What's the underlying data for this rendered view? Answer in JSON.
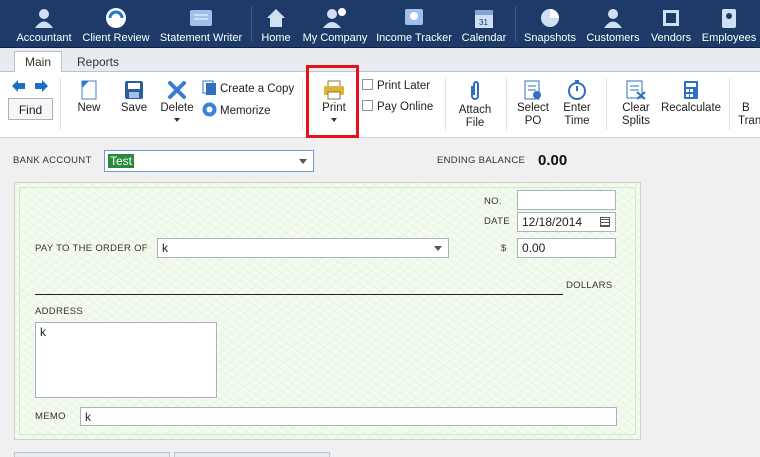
{
  "nav": {
    "items": [
      {
        "label": "Accountant",
        "icon": "accountant-icon"
      },
      {
        "label": "Client Review",
        "icon": "client-review-icon"
      },
      {
        "label": "Statement Writer",
        "icon": "statement-writer-icon"
      },
      {
        "label": "Home",
        "icon": "home-icon"
      },
      {
        "label": "My Company",
        "icon": "my-company-icon"
      },
      {
        "label": "Income Tracker",
        "icon": "income-tracker-icon"
      },
      {
        "label": "Calendar",
        "icon": "calendar-icon"
      },
      {
        "label": "Snapshots",
        "icon": "snapshots-icon"
      },
      {
        "label": "Customers",
        "icon": "customers-icon"
      },
      {
        "label": "Vendors",
        "icon": "vendors-icon"
      },
      {
        "label": "Employees",
        "icon": "employees-icon"
      }
    ]
  },
  "tabs": {
    "main": "Main",
    "reports": "Reports"
  },
  "toolbar": {
    "find": "Find",
    "new": "New",
    "save": "Save",
    "delete": "Delete",
    "create_copy": "Create a Copy",
    "memorize": "Memorize",
    "print": "Print",
    "print_later": "Print Later",
    "pay_online": "Pay Online",
    "attach_file_1": "Attach",
    "attach_file_2": "File",
    "select_po_1": "Select",
    "select_po_2": "PO",
    "enter_time_1": "Enter",
    "enter_time_2": "Time",
    "clear_splits_1": "Clear",
    "clear_splits_2": "Splits",
    "recalculate": "Recalculate",
    "batch_1": "B",
    "batch_2": "Tran"
  },
  "form": {
    "bank_account_label": "BANK ACCOUNT",
    "bank_account_value": "Test",
    "ending_balance_label": "ENDING BALANCE",
    "ending_balance_value": "0.00",
    "no_label": "NO.",
    "no_value": "",
    "date_label": "DATE",
    "date_value": "12/18/2014",
    "pay_to_label": "PAY TO THE ORDER OF",
    "pay_to_value": "k",
    "dollar_sign": "$",
    "amount_value": "0.00",
    "dollars_label": "DOLLARS",
    "address_label": "ADDRESS",
    "address_value": "k",
    "memo_label": "MEMO",
    "memo_value": "k"
  },
  "colors": {
    "nav_bg": "#1d3a68",
    "highlight": "#e3121b",
    "selected_value_bg": "#2a8a3a"
  }
}
